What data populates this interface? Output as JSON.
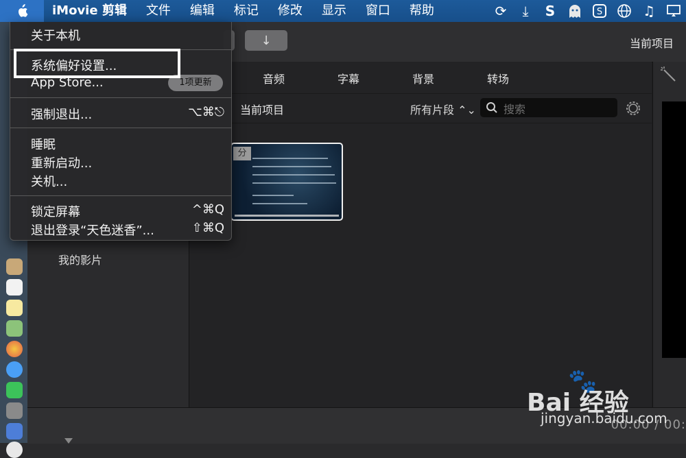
{
  "menubar": {
    "app": "iMovie 剪辑",
    "items": [
      "文件",
      "编辑",
      "标记",
      "修改",
      "显示",
      "窗口",
      "帮助"
    ],
    "status_icons": [
      "sync-icon",
      "download-icon",
      "s-icon",
      "ghost-icon",
      "sogou-icon",
      "globe-icon",
      "music-icon",
      "display-icon"
    ]
  },
  "apple_menu": {
    "about": "关于本机",
    "system_prefs": "系统偏好设置...",
    "app_store": "App Store...",
    "updates_badge": "1项更新",
    "force_quit": "强制退出...",
    "force_quit_shortcut": "⌥⌘⎋",
    "sleep": "睡眠",
    "restart": "重新启动...",
    "shutdown": "关机...",
    "lock": "锁定屏幕",
    "lock_shortcut": "^⌘Q",
    "logout": "退出登录“天色迷香”...",
    "logout_shortcut": "⇧⌘Q"
  },
  "toolbar": {
    "import_arrow": "↓",
    "project_title": "当前项目"
  },
  "tabs": [
    "音频",
    "字幕",
    "背景",
    "转场"
  ],
  "filter": {
    "current": "当前项目",
    "segments": "所有片段 ⌃⌄",
    "search_placeholder": "搜索"
  },
  "sidebar": {
    "library": "我的影片"
  },
  "clip": {
    "tag": "分"
  },
  "timecode": "00:00 / 00:",
  "watermark": {
    "brand": "Bai 经验",
    "url": "jingyan.baidu.com"
  },
  "colors": {
    "menubar": "#1d5a9a",
    "highlight_box": "#ffffff",
    "menu_bg": "#28282a"
  }
}
